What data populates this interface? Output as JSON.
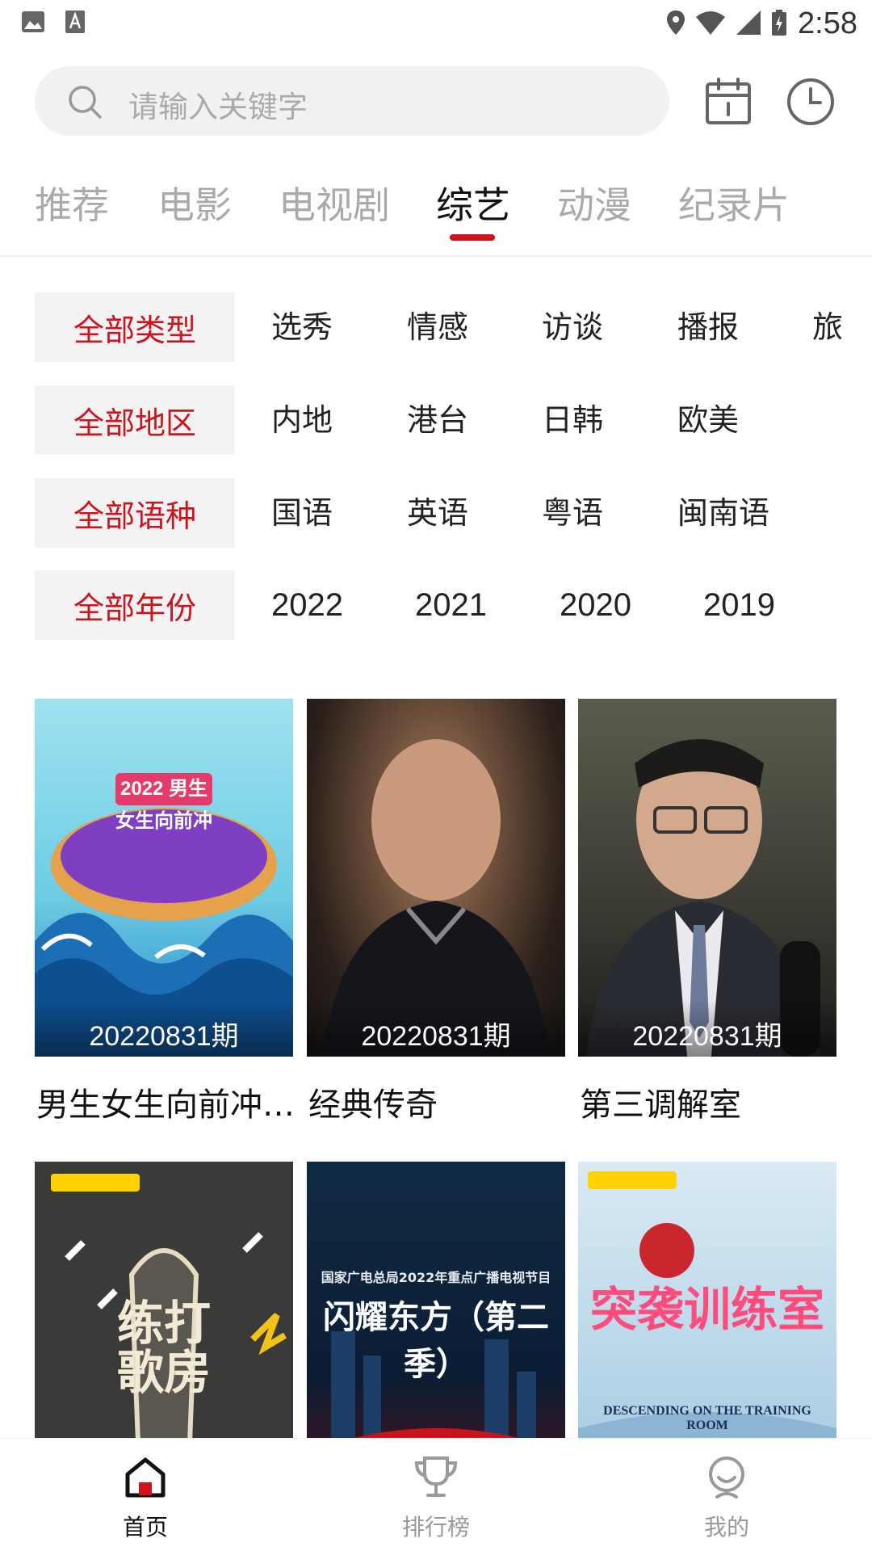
{
  "status_bar": {
    "time": "2:58"
  },
  "search": {
    "placeholder": "请输入关键字"
  },
  "tabs": [
    {
      "label": "推荐"
    },
    {
      "label": "电影"
    },
    {
      "label": "电视剧"
    },
    {
      "label": "综艺",
      "active": true
    },
    {
      "label": "动漫"
    },
    {
      "label": "纪录片"
    }
  ],
  "filters": {
    "type": {
      "all": "全部类型",
      "options": [
        "选秀",
        "情感",
        "访谈",
        "播报",
        "旅"
      ]
    },
    "region": {
      "all": "全部地区",
      "options": [
        "内地",
        "港台",
        "日韩",
        "欧美"
      ]
    },
    "language": {
      "all": "全部语种",
      "options": [
        "国语",
        "英语",
        "粤语",
        "闽南语"
      ]
    },
    "year": {
      "all": "全部年份",
      "options": [
        "2022",
        "2021",
        "2020",
        "2019"
      ]
    }
  },
  "cards": [
    {
      "title": "男生女生向前冲 …",
      "episode": "20220831期",
      "poster_text": "2022 男生女生向前冲"
    },
    {
      "title": "经典传奇",
      "episode": "20220831期"
    },
    {
      "title": "第三调解室",
      "episode": "20220831期"
    },
    {
      "title": "",
      "episode": "",
      "poster_text": "练打歌房"
    },
    {
      "title": "",
      "episode": "",
      "poster_text": "闪耀东方（第二季）",
      "poster_subtext": "国家广电总局2022年重点广播电视节目"
    },
    {
      "title": "",
      "episode": "",
      "poster_text": "突袭训练室",
      "poster_subtext": "DESCENDING ON THE TRAINING ROOM"
    }
  ],
  "bottom_nav": [
    {
      "label": "首页",
      "icon": "home-icon",
      "active": true
    },
    {
      "label": "排行榜",
      "icon": "trophy-icon"
    },
    {
      "label": "我的",
      "icon": "profile-icon"
    }
  ],
  "colors": {
    "accent": "#d0121d",
    "inactive": "#aaaaaa"
  }
}
